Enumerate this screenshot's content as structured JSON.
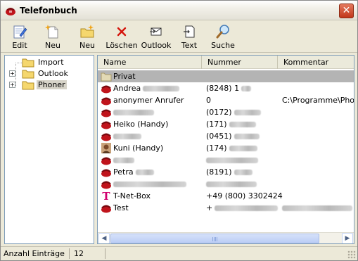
{
  "window": {
    "title": "Telefonbuch",
    "close_label": "✕"
  },
  "toolbar": {
    "buttons": [
      {
        "label": "Edit",
        "icon": "edit-icon"
      },
      {
        "label": "Neu",
        "icon": "new-contact-icon"
      },
      {
        "label": "Neu",
        "icon": "new-folder-icon"
      },
      {
        "label": "Löschen",
        "icon": "delete-icon"
      },
      {
        "label": "Outlook",
        "icon": "outlook-icon"
      },
      {
        "label": "Text",
        "icon": "text-export-icon"
      },
      {
        "label": "Suche",
        "icon": "search-icon"
      }
    ]
  },
  "tree": {
    "items": [
      {
        "label": "Import",
        "expandable": false
      },
      {
        "label": "Outlook",
        "expandable": true
      },
      {
        "label": "Phoner",
        "expandable": true,
        "selected": true
      }
    ],
    "expander": "+"
  },
  "list": {
    "columns": [
      "Name",
      "Nummer",
      "Kommentar"
    ],
    "rows": [
      {
        "name": "Privat",
        "number": "",
        "comment": "",
        "icon": "folder-icon",
        "selected": true
      },
      {
        "name": "Andrea",
        "number": "(8248) 1",
        "comment": "",
        "icon": "phone-icon"
      },
      {
        "name": "anonymer Anrufer",
        "number": "0",
        "comment": "C:\\Programme\\Phone",
        "icon": "phone-icon"
      },
      {
        "name": "",
        "number": "(0172)",
        "comment": "",
        "icon": "phone-icon"
      },
      {
        "name": "Heiko (Handy)",
        "number": "(171)",
        "comment": "",
        "icon": "phone-icon"
      },
      {
        "name": "",
        "number": "(0451)",
        "comment": "",
        "icon": "phone-icon"
      },
      {
        "name": "Kuni (Handy)",
        "number": "(174)",
        "comment": "",
        "icon": "person-photo-icon"
      },
      {
        "name": "",
        "number": "",
        "comment": "",
        "icon": "phone-icon"
      },
      {
        "name": "Petra",
        "number": "(8191)",
        "comment": "",
        "icon": "phone-icon"
      },
      {
        "name": "",
        "number": "",
        "comment": "",
        "icon": "phone-icon"
      },
      {
        "name": "T-Net-Box",
        "number": "+49 (800) 3302424",
        "comment": "",
        "icon": "t-logo-icon"
      },
      {
        "name": "Test",
        "number": "+",
        "comment": "",
        "icon": "phone-icon"
      }
    ]
  },
  "scrollbar": {
    "left_arrow": "◀",
    "right_arrow": "▶"
  },
  "status": {
    "label": "Anzahl Einträge",
    "count": "12"
  },
  "colors": {
    "phone_red": "#c0141c",
    "folder_yellow": "#f5d76e",
    "selection_gray": "#b4b4b4"
  }
}
